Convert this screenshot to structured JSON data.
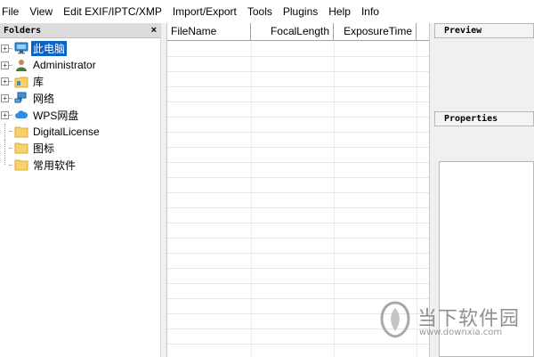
{
  "menubar": {
    "items": [
      "File",
      "View",
      "Edit EXIF/IPTC/XMP",
      "Import/Export",
      "Tools",
      "Plugins",
      "Help",
      "Info"
    ]
  },
  "folders_panel": {
    "title": "Folders",
    "close_glyph": "×",
    "tree": [
      {
        "label": "此电脑",
        "icon": "computer-icon",
        "expandable": true,
        "selected": true
      },
      {
        "label": "Administrator",
        "icon": "user-icon",
        "expandable": true,
        "selected": false
      },
      {
        "label": "库",
        "icon": "library-folder-icon",
        "expandable": true,
        "selected": false
      },
      {
        "label": "网络",
        "icon": "network-icon",
        "expandable": true,
        "selected": false
      },
      {
        "label": "WPS网盘",
        "icon": "cloud-icon",
        "expandable": true,
        "selected": false
      },
      {
        "label": "DigitalLicense",
        "icon": "folder-icon",
        "expandable": false,
        "selected": false
      },
      {
        "label": "图标",
        "icon": "folder-icon",
        "expandable": false,
        "selected": false
      },
      {
        "label": "常用软件",
        "icon": "folder-icon",
        "expandable": false,
        "selected": false
      }
    ]
  },
  "file_list": {
    "columns": [
      "FileName",
      "FocalLength",
      "ExposureTime"
    ]
  },
  "preview_panel": {
    "title": "Preview"
  },
  "properties_panel": {
    "title": "Properties"
  },
  "watermark": {
    "brand": "当下软件园",
    "url": "www.downxia.com"
  },
  "colors": {
    "selection": "#0a64c8",
    "folder_yellow": "#f7d26b"
  }
}
